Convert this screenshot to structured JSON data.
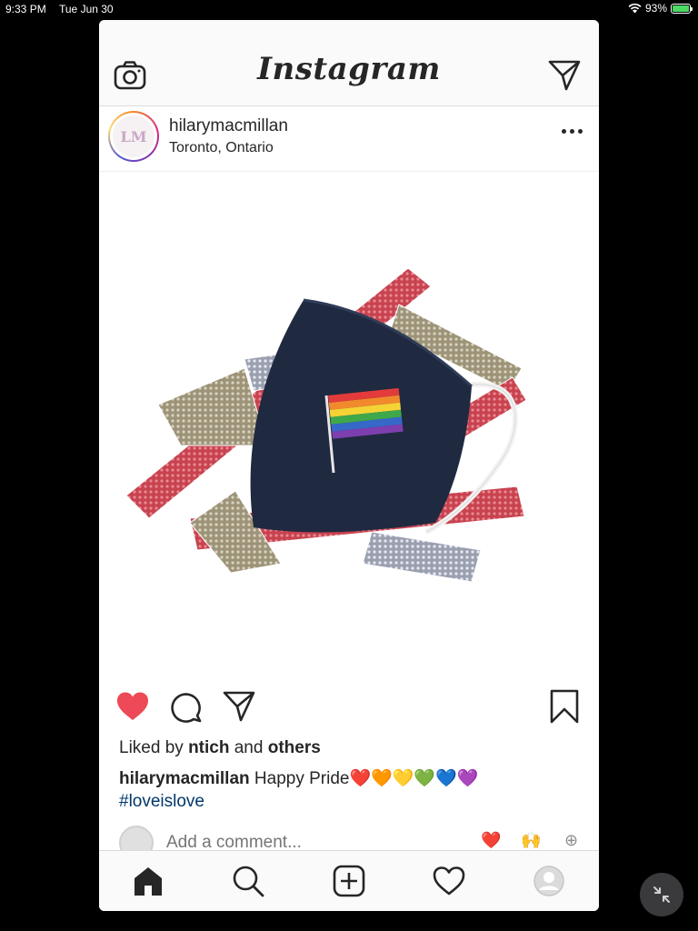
{
  "status": {
    "time": "9:33 PM",
    "date": "Tue Jun 30",
    "battery": "93%",
    "battery_level": 0.93
  },
  "header": {
    "logo": "Instagram",
    "left_icon": "camera-icon",
    "right_icon": "direct-send-icon"
  },
  "post": {
    "username": "hilarymacmillan",
    "location": "Toronto, Ontario",
    "avatar_initials": "LM",
    "more_icon": "more-dots-icon",
    "image_alt": "Navy face mask with embroidered rainbow flag on rhinestone LOVE straps",
    "liked": true,
    "likes_prefix": "Liked by",
    "liked_by": "ntich",
    "likes_middle": "and",
    "likes_suffix": "others",
    "caption_user": "hilarymacmillan",
    "caption_text": "Happy Pride❤️🧡💛💚💙💜",
    "hashtag": "#loveislove",
    "comment_placeholder": "Add a comment...",
    "quick_reactions": [
      "❤️",
      "🙌",
      "⊕"
    ]
  },
  "tabbar": {
    "items": [
      "home-icon",
      "search-icon",
      "new-post-icon",
      "activity-heart-icon",
      "profile-icon"
    ]
  },
  "colors": {
    "like_red": "#ed4956",
    "text": "#262626",
    "hashtag": "#00376b",
    "border": "#dbdbdb"
  }
}
